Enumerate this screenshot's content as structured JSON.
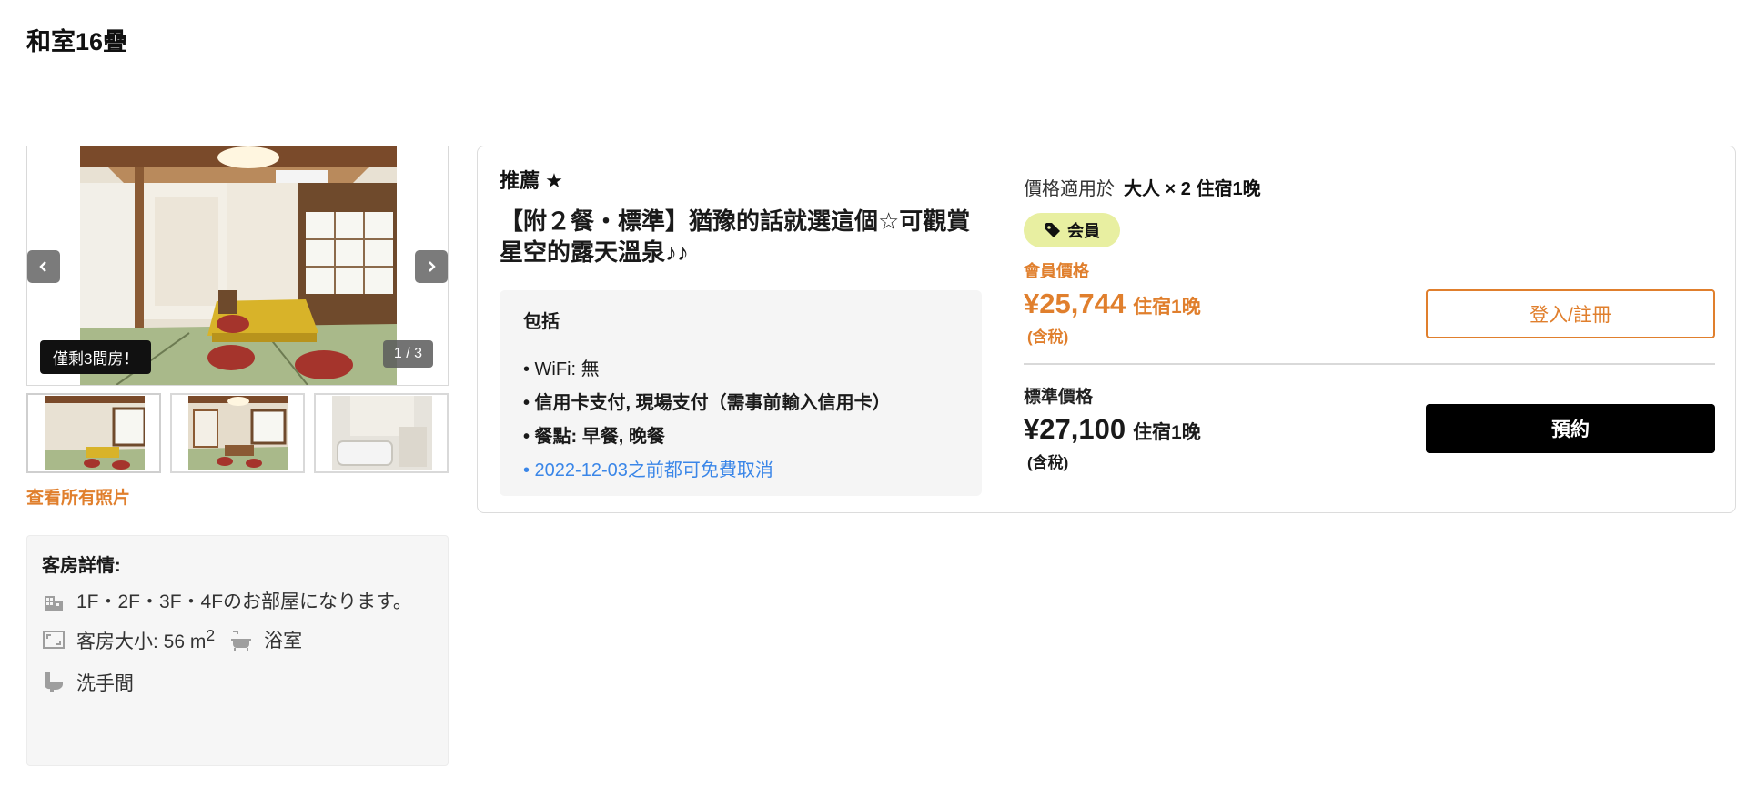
{
  "room": {
    "title": "和室16疊"
  },
  "gallery": {
    "rooms_left": "僅剩3間房！",
    "counter": "1 / 3",
    "view_all": "查看所有照片",
    "prev_icon": "chevron-left-icon",
    "next_icon": "chevron-right-icon"
  },
  "details": {
    "title": "客房詳情:",
    "floors": "1F・2F・3F・4Fのお部屋になります。",
    "size_label": "客房大小: 56 m",
    "size_unit_sup": "2",
    "bath": "浴室",
    "toilet": "洗手間",
    "icons": [
      "building-icon",
      "room-size-icon",
      "bathtub-icon",
      "toilet-icon"
    ]
  },
  "plan": {
    "recommend": "推薦 ★",
    "name": "【附２餐・標準】猶豫的話就選這個☆可觀賞星空的露天溫泉♪♪",
    "include_title": "包括",
    "includes": [
      "• WiFi: 無",
      "• 信用卡支付, 現場支付（需事前輸入信用卡）",
      "• 餐點: 早餐, 晚餐",
      "• 2022-12-03之前都可免費取消"
    ],
    "applies_label": "價格適用於",
    "applies_value": "大人 × 2 住宿1晚",
    "member_badge": "会員",
    "member_label": "會員價格",
    "member_price": "¥25,744",
    "member_per": "住宿1晚",
    "member_tax": "(含稅)",
    "std_label": "標準價格",
    "std_price": "¥27,100",
    "std_per": "住宿1晚",
    "std_tax": "(含稅)",
    "login_button": "登入/註冊",
    "book_button": "預約"
  },
  "colors": {
    "accent_orange": "#e07f2d",
    "link_blue": "#3a86e8",
    "badge_green": "#e8efa1"
  }
}
